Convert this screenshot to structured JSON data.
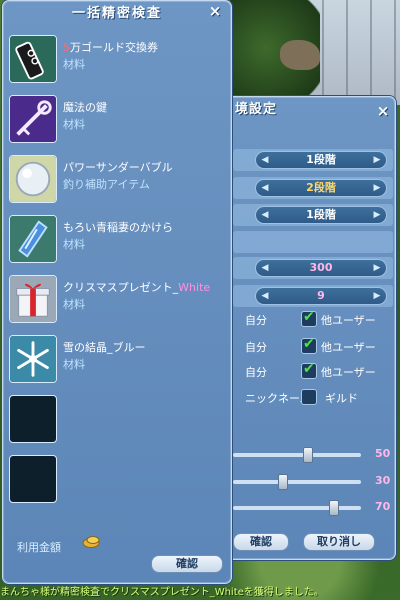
{
  "inspect_panel": {
    "title": "一括精密検査",
    "close": "×",
    "items": [
      {
        "name_prefix": "5",
        "name_main": "万ゴールド交換券",
        "category": "材料",
        "icon": "gold-voucher-icon"
      },
      {
        "name_main": "魔法の鍵",
        "category": "材料",
        "icon": "magic-key-icon"
      },
      {
        "name_main": "パワーサンダーバブル",
        "category": "釣り補助アイテム",
        "icon": "thunder-bubble-icon"
      },
      {
        "name_main": "もろい青稲妻のかけら",
        "category": "材料",
        "icon": "blue-lightning-shard-icon"
      },
      {
        "name_main": "クリスマスプレゼント_",
        "name_suffix": "White",
        "category": "材料",
        "icon": "christmas-present-icon"
      },
      {
        "name_main": "雪の結晶_ブルー",
        "category": "材料",
        "icon": "snow-crystal-icon"
      }
    ],
    "fee_label": "利用金額",
    "confirm_button": "確認"
  },
  "settings_panel": {
    "title": "境設定",
    "close": "×",
    "steppers": [
      {
        "value": "1段階",
        "color": "white"
      },
      {
        "value": "2段階",
        "color": "gold"
      },
      {
        "value": "1段階",
        "color": "white"
      },
      {
        "value": "300",
        "color": "pink"
      },
      {
        "value": "9",
        "color": "pink"
      }
    ],
    "checks": [
      {
        "self_label": "自分",
        "other_label": "他ユーザー",
        "other_checked": true
      },
      {
        "self_label": "自分",
        "other_label": "他ユーザー",
        "other_checked": true
      },
      {
        "self_label": "自分",
        "other_label": "他ユーザー",
        "other_checked": true
      }
    ],
    "name_row": {
      "nickname_label": "ニックネーム",
      "guild_label": "ギルド"
    },
    "sliders": [
      {
        "value": 50
      },
      {
        "value": 30
      },
      {
        "value": 70
      }
    ],
    "confirm_button": "確認",
    "cancel_button": "取り消し"
  },
  "system_message": "まんちゃ様が精密検査でクリスマスプレゼント_Whiteを獲得しました。",
  "colors": {
    "panel": "#6e96c4",
    "accent_green": "#4fe04a",
    "message": "#d7ff7a"
  }
}
